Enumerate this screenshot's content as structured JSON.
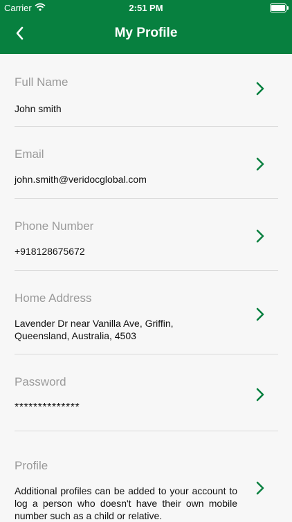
{
  "status_bar": {
    "carrier": "Carrier",
    "time": "2:51 PM"
  },
  "header": {
    "title": "My Profile"
  },
  "profile_items": [
    {
      "label": "Full Name",
      "value": "John smith"
    },
    {
      "label": "Email",
      "value": "john.smith@veridocglobal.com"
    },
    {
      "label": "Phone Number",
      "value": "+918128675672"
    },
    {
      "label": "Home Address",
      "value": "Lavender Dr near Vanilla Ave, Griffin, Queensland, Australia, 4503"
    },
    {
      "label": "Password",
      "value": "**************"
    },
    {
      "label": "Profile",
      "value": "Additional profiles can be added to your account to log a person who doesn't have their own mobile number such as a child or relative."
    }
  ],
  "colors": {
    "brand": "#07803f",
    "background": "#f7f7f7",
    "label": "#9a9a9a"
  },
  "icons": {
    "back": "chevron-left-icon",
    "row": "chevron-right-icon",
    "wifi": "wifi-icon",
    "battery": "battery-icon"
  }
}
